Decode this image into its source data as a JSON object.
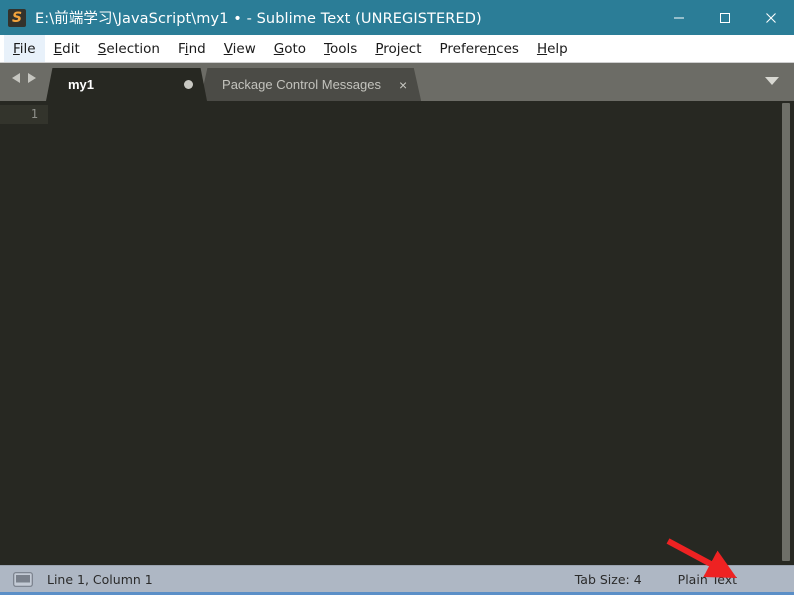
{
  "window": {
    "title": "E:\\前端学习\\JavaScript\\my1 • - Sublime Text (UNREGISTERED)",
    "app_icon": "sublime-text-icon",
    "accent_color": "#2b7d97",
    "controls": {
      "minimize": "minimize-icon",
      "maximize": "maximize-icon",
      "close": "close-icon"
    }
  },
  "menubar": {
    "items": [
      {
        "label": "File",
        "mnemonic": "F",
        "active": true
      },
      {
        "label": "Edit",
        "mnemonic": "E",
        "active": false
      },
      {
        "label": "Selection",
        "mnemonic": "S",
        "active": false
      },
      {
        "label": "Find",
        "mnemonic": "i",
        "active": false
      },
      {
        "label": "View",
        "mnemonic": "V",
        "active": false
      },
      {
        "label": "Goto",
        "mnemonic": "G",
        "active": false
      },
      {
        "label": "Tools",
        "mnemonic": "T",
        "active": false
      },
      {
        "label": "Project",
        "mnemonic": "P",
        "active": false
      },
      {
        "label": "Preferences",
        "mnemonic": "n",
        "active": false
      },
      {
        "label": "Help",
        "mnemonic": "H",
        "active": false
      }
    ]
  },
  "tabbar": {
    "nav_prev": "arrow-left-icon",
    "nav_next": "arrow-right-icon",
    "dropdown": "chevron-down-icon",
    "tabs": [
      {
        "label": "my1",
        "active": true,
        "modified": true,
        "modified_indicator": "•"
      },
      {
        "label": "Package Control Messages",
        "active": false,
        "close": "×"
      }
    ]
  },
  "editor": {
    "background_color": "#272822",
    "line_numbers": [
      "1"
    ],
    "lines": [
      ""
    ],
    "caret_line": 1,
    "caret_column": 1
  },
  "statusbar": {
    "sidebar_toggle_icon": "sidebar-toggle-icon",
    "position": "Line 1, Column 1",
    "tab_size": "Tab Size: 4",
    "syntax": "Plain Text"
  },
  "annotation": {
    "arrow_color": "#ee2222",
    "points_at": "Plain Text"
  }
}
